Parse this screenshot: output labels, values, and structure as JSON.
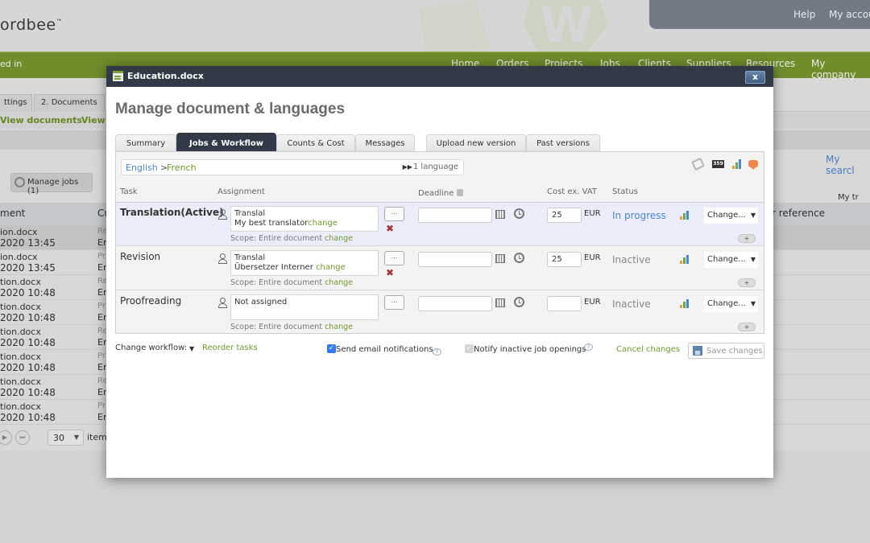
{
  "background": {
    "logo": "ordbee",
    "top_links": [
      "Help",
      "My accou"
    ],
    "logged_in_text": "ed in",
    "nav": [
      "Home",
      "Orders",
      "Projects",
      "Jobs",
      "Clients",
      "Suppliers",
      "Resources",
      "My company"
    ],
    "tabs": [
      "ttings",
      "2. Documents"
    ],
    "subnav": [
      "View documents",
      "View"
    ],
    "my_tr": "My tr",
    "manage_jobs": "Manage jobs (1)",
    "my_search": "My searcl",
    "table_headers": [
      "ment",
      "Cu",
      "r reference"
    ],
    "rows": [
      {
        "name": "ion.docx",
        "date": "2020 13:45",
        "type": "Re",
        "lang": "Er"
      },
      {
        "name": "ion.docx",
        "date": "2020 13:45",
        "type": "Pr",
        "lang": "Er"
      },
      {
        "name": "tion.docx",
        "date": "2020 10:48",
        "type": "Re",
        "lang": "Er"
      },
      {
        "name": "tion.docx",
        "date": "2020 10:48",
        "type": "Pr",
        "lang": "Er"
      },
      {
        "name": "tion.docx",
        "date": "2020 10:48",
        "type": "Re",
        "lang": "Er"
      },
      {
        "name": "tion.docx",
        "date": "2020 10:48",
        "type": "Pr",
        "lang": "Er"
      },
      {
        "name": "tion.docx",
        "date": "2020 10:48",
        "type": "Re",
        "lang": "Er"
      },
      {
        "name": "tion.docx",
        "date": "2020 10:48",
        "type": "Pr",
        "lang": "Er"
      }
    ],
    "pager": {
      "page_size": "30",
      "items_label": "item"
    }
  },
  "modal": {
    "title": "Education.docx",
    "close_label": "x",
    "heading": "Manage document & languages",
    "tabs": [
      {
        "label": "Summary",
        "active": false
      },
      {
        "label": "Jobs & Workflow",
        "active": true
      },
      {
        "label": "Counts & Cost",
        "active": false
      },
      {
        "label": "Messages",
        "active": false
      },
      {
        "label": "Upload new version",
        "active": false
      },
      {
        "label": "Past versions",
        "active": false
      }
    ],
    "language": {
      "source": "English",
      "separator": ">",
      "target": "French",
      "count": "1 language"
    },
    "toolbar_icons": [
      "tag-icon",
      "counter-359-icon",
      "bar-chart-icon",
      "comment-icon"
    ],
    "counter_text": "359",
    "columns": {
      "task": "Task",
      "assignment": "Assignment",
      "deadline": "Deadline",
      "cost": "Cost ex. VAT",
      "status": "Status"
    },
    "tasks": [
      {
        "name": "Translation(Active)",
        "assignee_line1": "Translal",
        "assignee_line2": "My best translator",
        "change_label": "change",
        "scope_label": "Scope: Entire document",
        "scope_change": "change",
        "deadline": "",
        "cost": "25",
        "currency": "EUR",
        "status": "In progress",
        "action": "Change...",
        "removable": true
      },
      {
        "name": "Revision",
        "assignee_line1": "Translal",
        "assignee_line2": "Übersetzer Interner ",
        "change_label": "change",
        "scope_label": "Scope: Entire document",
        "scope_change": "change",
        "deadline": "",
        "cost": "25",
        "currency": "EUR",
        "status": "Inactive",
        "action": "Change...",
        "removable": true
      },
      {
        "name": "Proofreading",
        "assignee_line1": "Not assigned",
        "assignee_line2": "",
        "change_label": "",
        "scope_label": "Scope: Entire document",
        "scope_change": "change",
        "deadline": "",
        "cost": "",
        "currency": "EUR",
        "status": "Inactive",
        "action": "Change...",
        "removable": false
      }
    ],
    "dots_label": "...",
    "plus_label": "+",
    "footer": {
      "change_workflow": "Change workflow:",
      "reorder": "Reorder tasks",
      "send_email": "Send email notifications",
      "send_email_checked": true,
      "notify_inactive": "Notify inactive job openings",
      "notify_inactive_checked": true,
      "cancel": "Cancel changes",
      "save": "Save changes"
    }
  },
  "colors": {
    "nav_green": "#7a9a2f",
    "titlebar": "#313a46",
    "link_blue": "#4a86d4",
    "link_green": "#6f9a2c",
    "comment_orange": "#f0884a"
  }
}
